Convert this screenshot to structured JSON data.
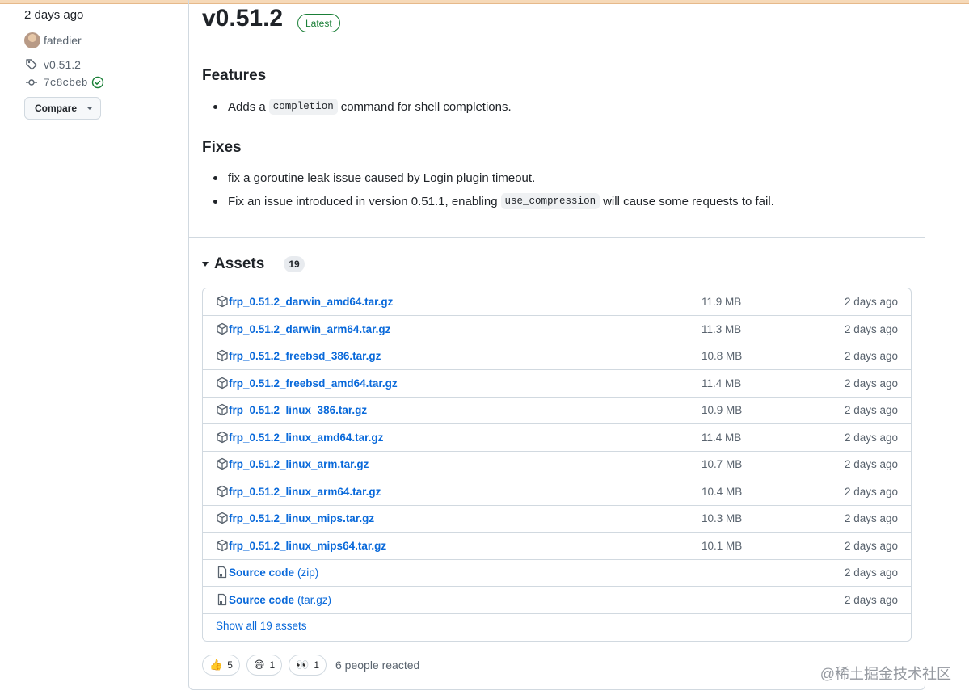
{
  "sidebar": {
    "date": "2 days ago",
    "author": "fatedier",
    "tag": "v0.51.2",
    "commit": "7c8cbeb",
    "compare_label": "Compare"
  },
  "release": {
    "title": "v0.51.2",
    "badge": "Latest"
  },
  "notes": {
    "features_heading": "Features",
    "feature_1_pre": "Adds a",
    "feature_1_code": "completion",
    "feature_1_post": "command for shell completions.",
    "fixes_heading": "Fixes",
    "fix_1": "fix a goroutine leak issue caused by Login plugin timeout.",
    "fix_2_pre": "Fix an issue introduced in version 0.51.1, enabling",
    "fix_2_code": "use_compression",
    "fix_2_post": "will cause some requests to fail."
  },
  "assets": {
    "title": "Assets",
    "count": "19",
    "show_all": "Show all 19 assets",
    "items": [
      {
        "name": "frp_0.51.2_darwin_amd64.tar.gz",
        "ext": "",
        "size": "11.9 MB",
        "date": "2 days ago",
        "icon": "package-icon"
      },
      {
        "name": "frp_0.51.2_darwin_arm64.tar.gz",
        "ext": "",
        "size": "11.3 MB",
        "date": "2 days ago",
        "icon": "package-icon"
      },
      {
        "name": "frp_0.51.2_freebsd_386.tar.gz",
        "ext": "",
        "size": "10.8 MB",
        "date": "2 days ago",
        "icon": "package-icon"
      },
      {
        "name": "frp_0.51.2_freebsd_amd64.tar.gz",
        "ext": "",
        "size": "11.4 MB",
        "date": "2 days ago",
        "icon": "package-icon"
      },
      {
        "name": "frp_0.51.2_linux_386.tar.gz",
        "ext": "",
        "size": "10.9 MB",
        "date": "2 days ago",
        "icon": "package-icon"
      },
      {
        "name": "frp_0.51.2_linux_amd64.tar.gz",
        "ext": "",
        "size": "11.4 MB",
        "date": "2 days ago",
        "icon": "package-icon"
      },
      {
        "name": "frp_0.51.2_linux_arm.tar.gz",
        "ext": "",
        "size": "10.7 MB",
        "date": "2 days ago",
        "icon": "package-icon"
      },
      {
        "name": "frp_0.51.2_linux_arm64.tar.gz",
        "ext": "",
        "size": "10.4 MB",
        "date": "2 days ago",
        "icon": "package-icon"
      },
      {
        "name": "frp_0.51.2_linux_mips.tar.gz",
        "ext": "",
        "size": "10.3 MB",
        "date": "2 days ago",
        "icon": "package-icon"
      },
      {
        "name": "frp_0.51.2_linux_mips64.tar.gz",
        "ext": "",
        "size": "10.1 MB",
        "date": "2 days ago",
        "icon": "package-icon"
      },
      {
        "name": "Source code",
        "ext": "(zip)",
        "size": "",
        "date": "2 days ago",
        "icon": "file-zip-icon"
      },
      {
        "name": "Source code",
        "ext": "(tar.gz)",
        "size": "",
        "date": "2 days ago",
        "icon": "file-zip-icon"
      }
    ]
  },
  "reactions": {
    "items": [
      {
        "emoji": "👍",
        "count": "5",
        "icon": "thumbs-up-icon"
      },
      {
        "emoji": "😄",
        "count": "1",
        "icon": "laugh-icon"
      },
      {
        "emoji": "👀",
        "count": "1",
        "icon": "eyes-icon"
      }
    ],
    "summary": "6 people reacted"
  },
  "watermark": "@稀土掘金技术社区",
  "colors": {
    "link": "#0969da",
    "latest_badge": "#1a7f37",
    "muted": "#59636e",
    "border": "#d1d9e0"
  }
}
